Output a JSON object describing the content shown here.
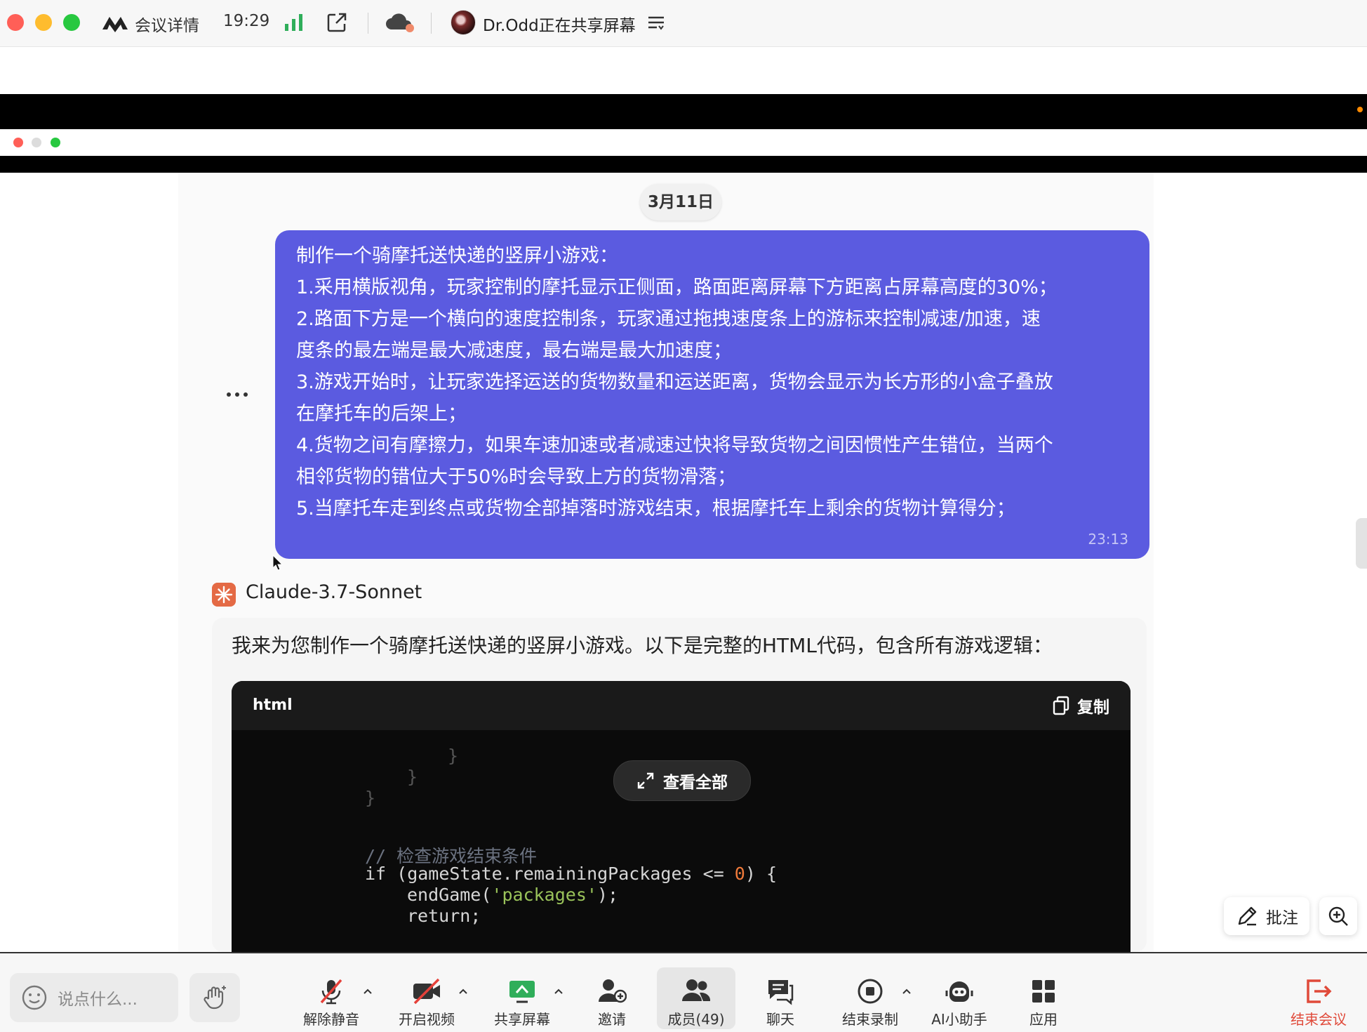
{
  "topbar": {
    "meeting_details": "会议详情",
    "time": "19:29",
    "sharer_text": "Dr.Odd正在共享屏幕"
  },
  "chat": {
    "date": "3月11日",
    "user_message": {
      "lines": [
        "制作一个骑摩托送快递的竖屏小游戏：",
        "1.采用横版视角，玩家控制的摩托显示正侧面，路面距离屏幕下方距离占屏幕高度的30%；",
        "2.路面下方是一个横向的速度控制条，玩家通过拖拽速度条上的游标来控制减速/加速，速",
        "度条的最左端是最大减速度，最右端是最大加速度；",
        "3.游戏开始时，让玩家选择运送的货物数量和运送距离，货物会显示为长方形的小盒子叠放",
        "在摩托车的后架上；",
        "4.货物之间有摩擦力，如果车速加速或者减速过快将导致货物之间因惯性产生错位，当两个",
        "相邻货物的错位大于50%时会导致上方的货物滑落；",
        "5.当摩托车走到终点或货物全部掉落时游戏结束，根据摩托车上剩余的货物计算得分；"
      ],
      "time": "23:13"
    },
    "model_name": "Claude-3.7-Sonnet",
    "answer_intro": "我来为您制作一个骑摩托送快递的竖屏小游戏。以下是完整的HTML代码，包含所有游戏逻辑：",
    "code": {
      "language": "html",
      "copy_label": "复制",
      "expand_label": "查看全部",
      "brace": "}",
      "comment": "// 检查游戏结束条件",
      "if_start": "if (gameState.remainingPackages <= ",
      "if_num": "0",
      "if_end": ") {",
      "call_start": "endGame(",
      "call_str": "'packages'",
      "call_end": ");",
      "return_stmt": "return;"
    }
  },
  "floating_tools": {
    "annotate_label": "批注"
  },
  "toolbar": {
    "chat_placeholder": "说点什么...",
    "unmute": "解除静音",
    "start_video": "开启视频",
    "share_screen": "共享屏幕",
    "invite": "邀请",
    "members": "成员(49)",
    "chat": "聊天",
    "end_recording": "结束录制",
    "ai_assistant": "AI小助手",
    "apps": "应用",
    "end_meeting": "结束会议"
  },
  "colors": {
    "user_bubble": "#5b5be0",
    "code_bg": "#0b0b0b",
    "end_meeting": "#e04a3a",
    "share_icon": "#2fae5a"
  }
}
